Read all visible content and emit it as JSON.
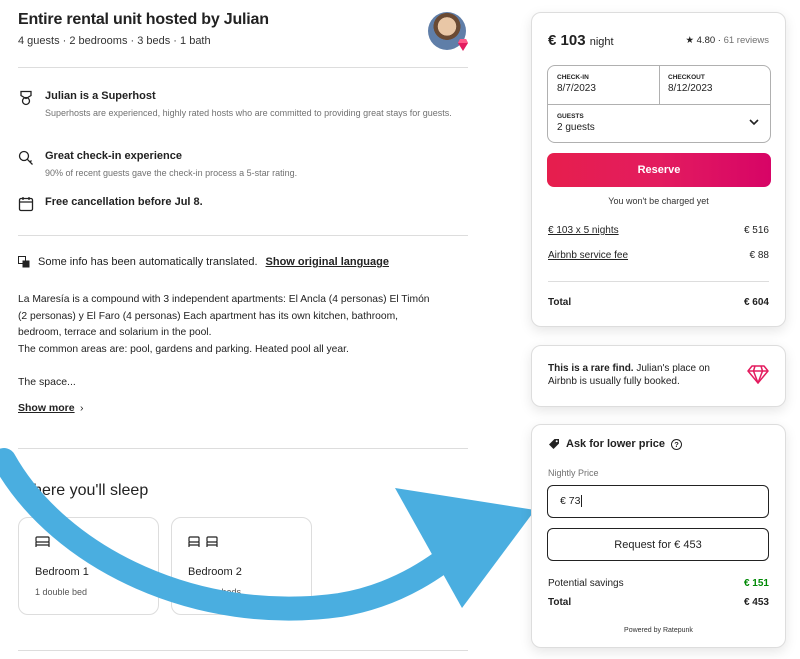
{
  "listing": {
    "title": "Entire rental unit hosted by Julian",
    "subtitle": "4 guests · 2 bedrooms · 3 beds · 1 bath"
  },
  "features": [
    {
      "icon": "superhost-medal-icon",
      "title": "Julian is a Superhost",
      "desc": "Superhosts are experienced, highly rated hosts who are committed to providing great stays for guests."
    },
    {
      "icon": "key-icon",
      "title": "Great check-in experience",
      "desc": "90% of recent guests gave the check-in process a 5-star rating."
    },
    {
      "icon": "calendar-icon",
      "title": "Free cancellation before Jul 8.",
      "desc": ""
    }
  ],
  "translation": {
    "text": "Some info has been automatically translated.",
    "link": "Show original language"
  },
  "description": {
    "lines": [
      "La Maresía is a compound with 3 independent apartments: El Ancla (4 personas) El Timón",
      "(2 personas) y El Faro (4 personas) Each apartment has its own kitchen, bathroom,",
      "bedroom, terrace and solarium in the pool.",
      "The common areas are: pool, gardens and parking. Heated pool all year."
    ],
    "space": "The space...",
    "show_more": "Show more",
    "show_more_chevron": "›"
  },
  "sleep": {
    "title": "Where you'll sleep",
    "rooms": [
      {
        "name": "Bedroom 1",
        "desc": "1 double bed"
      },
      {
        "name": "Bedroom 2",
        "desc": "2 single beds"
      }
    ]
  },
  "booking": {
    "price": "€ 103",
    "unit": "night",
    "rating": "★ 4.80 ·",
    "reviews": "61 reviews",
    "checkin_label": "CHECK-IN",
    "checkin_value": "8/7/2023",
    "checkout_label": "CHECKOUT",
    "checkout_value": "8/12/2023",
    "guests_label": "GUESTS",
    "guests_value": "2 guests",
    "reserve_label": "Reserve",
    "not_charged": "You won't be charged yet",
    "nights_label": "€ 103 x 5 nights",
    "nights_value": "€ 516",
    "fee_label": "Airbnb service fee",
    "fee_value": "€ 88",
    "total_label": "Total",
    "total_value": "€ 604"
  },
  "rare": {
    "bold": "This is a rare find.",
    "text": " Julian's place on Airbnb is usually fully booked."
  },
  "ask": {
    "title": "Ask for lower price",
    "help": "?",
    "nightly_label": "Nightly Price",
    "nightly_value": "€  73",
    "request_label": "Request for € 453",
    "savings_label": "Potential savings",
    "savings_value": "€ 151",
    "total_label": "Total",
    "total_value": "€ 453",
    "powered": "Powered by Ratepunk"
  },
  "colors": {
    "reserve_start": "#e61e4d",
    "reserve_end": "#d70466",
    "savings_green": "#008a05",
    "arrow_blue": "#4aaee0",
    "diamond_red": "#e31c5f"
  }
}
